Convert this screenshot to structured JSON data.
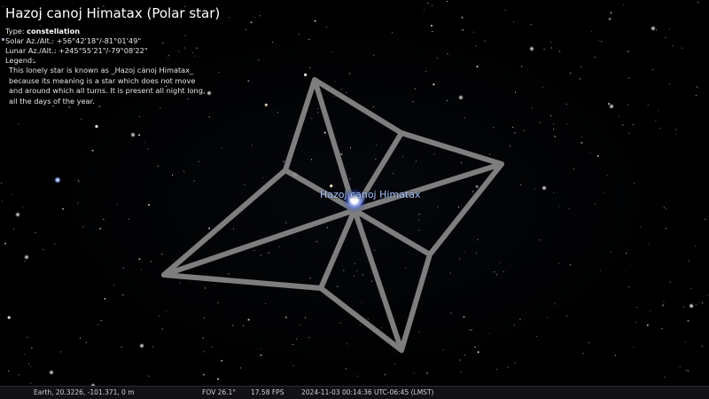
{
  "object": {
    "title": "Hazoj canoj Himatax (Polar star)",
    "type_label": "Type: ",
    "type_value": "constellation",
    "solar_line": "Solar Az./Alt.: +56°42'18\"/-81°01'49\"",
    "lunar_line": "Lunar Az./Alt.: +245°55'21\"/-79°08'22\"",
    "legend_label": "Legend:",
    "legend_text": "This lonely star is known as _Hazoj canoj Himatax_ because its meaning is a star which does not move and around which all turns. It is present all night long, all the days of the year."
  },
  "sky": {
    "constellation_label": "Hazoj canoj Himatax",
    "line_color": "#8c8c8c",
    "label_color": "#a9c6ff"
  },
  "status": {
    "location": "Earth, 20.3226, -101.371, 0 m",
    "fov": "FOV 26.1°",
    "fps": "17.58 FPS",
    "datetime": "2024-11-03 00:14:36 UTC-06:45 (LMST)"
  }
}
